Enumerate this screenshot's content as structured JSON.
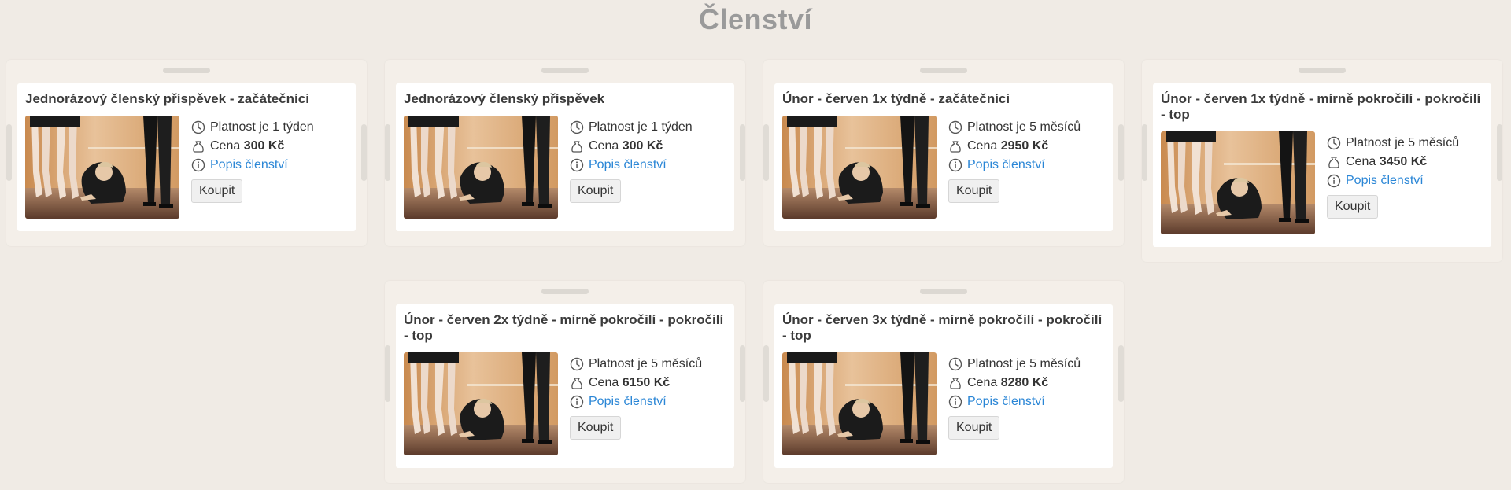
{
  "page": {
    "title": "Členství"
  },
  "labels": {
    "validity_prefix": "Platnost je",
    "price_prefix": "Cena",
    "description_link": "Popis členství",
    "buy_button": "Koupit"
  },
  "cards": [
    {
      "title": "Jednorázový členský příspěvek - začátečníci",
      "validity": "1 týden",
      "price": "300 Kč"
    },
    {
      "title": "Jednorázový členský příspěvek",
      "validity": "1 týden",
      "price": "300 Kč"
    },
    {
      "title": "Únor - červen 1x týdně - začátečníci",
      "validity": "5 měsíců",
      "price": "2950 Kč"
    },
    {
      "title": "Únor - červen 1x týdně - mírně pokročilí - pokročilí - top",
      "validity": "5 měsíců",
      "price": "3450 Kč"
    },
    {
      "title": "Únor - červen 2x týdně - mírně pokročilí - pokročilí - top",
      "validity": "5 měsíců",
      "price": "6150 Kč"
    },
    {
      "title": "Únor - červen 3x týdně - mírně pokročilí - pokročilí - top",
      "validity": "5 měsíců",
      "price": "8280 Kč"
    }
  ],
  "icons": {
    "validity": "clock-icon",
    "price": "money-bag-icon",
    "description": "info-icon",
    "image": "ballet-class-photo"
  },
  "colors": {
    "background": "#f0ebe5",
    "link": "#2a86d6",
    "title": "#9a9a9a"
  }
}
